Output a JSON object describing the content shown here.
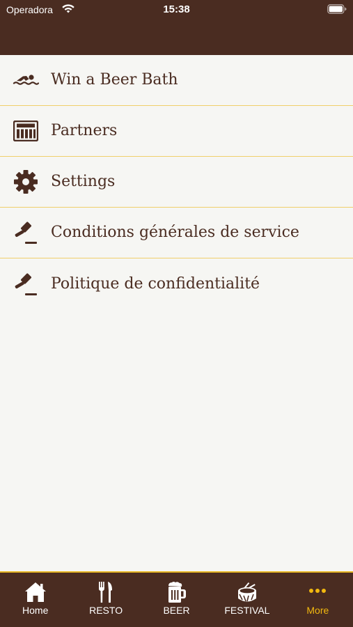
{
  "status_bar": {
    "carrier": "Operadora",
    "time": "15:38",
    "icons": [
      "wifi-icon",
      "battery-icon"
    ]
  },
  "colors": {
    "brand_brown": "#4a2c21",
    "accent_gold": "#f2b90f",
    "divider": "#f0cf6a",
    "background": "#f6f6f3"
  },
  "menu": {
    "items": [
      {
        "label": "Win a Beer Bath",
        "icon": "swimmer-icon"
      },
      {
        "label": "Partners",
        "icon": "newspaper-icon"
      },
      {
        "label": "Settings",
        "icon": "gear-icon"
      },
      {
        "label": "Conditions générales de service",
        "icon": "gavel-icon"
      },
      {
        "label": "Politique de confidentialité",
        "icon": "gavel-icon"
      }
    ]
  },
  "tabbar": {
    "tabs": [
      {
        "label": "Home",
        "icon": "home-icon"
      },
      {
        "label": "RESTO",
        "icon": "fork-knife-icon"
      },
      {
        "label": "BEER",
        "icon": "beer-mug-icon"
      },
      {
        "label": "FESTIVAL",
        "icon": "drum-icon"
      },
      {
        "label": "More",
        "icon": "more-dots-icon",
        "active": true
      }
    ]
  }
}
